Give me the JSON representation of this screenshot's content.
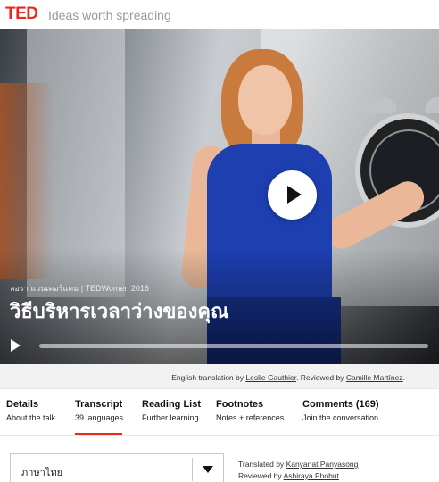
{
  "header": {
    "logo": "TED",
    "tagline": "Ideas worth spreading"
  },
  "video": {
    "speaker_event": "ลอรา แวนเดอร์แคม | TEDWomen 2016",
    "title": "วิธีบริหารเวลาว่างของคุณ"
  },
  "credits": {
    "prefix": "English translation by",
    "translator": "Leslie Gauthier",
    "middle": ". Reviewed by",
    "reviewer": "Camille Martínez",
    "suffix": "."
  },
  "tabs": [
    {
      "label": "Details",
      "sub": "About the talk"
    },
    {
      "label": "Transcript",
      "sub": "39 languages"
    },
    {
      "label": "Reading List",
      "sub": "Further learning"
    },
    {
      "label": "Footnotes",
      "sub": "Notes + references"
    },
    {
      "label": "Comments (169)",
      "sub": "Join the conversation"
    }
  ],
  "transcript": {
    "language": "ภาษาไทย",
    "translated_by_label": "Translated by",
    "translated_by": "Kanyanat Panyasong",
    "reviewed_by_label": "Reviewed by",
    "reviewed_by": "Ashiraya Phobut"
  },
  "colors": {
    "accent": "#e62b1e",
    "dress": "#1d3fb0"
  }
}
